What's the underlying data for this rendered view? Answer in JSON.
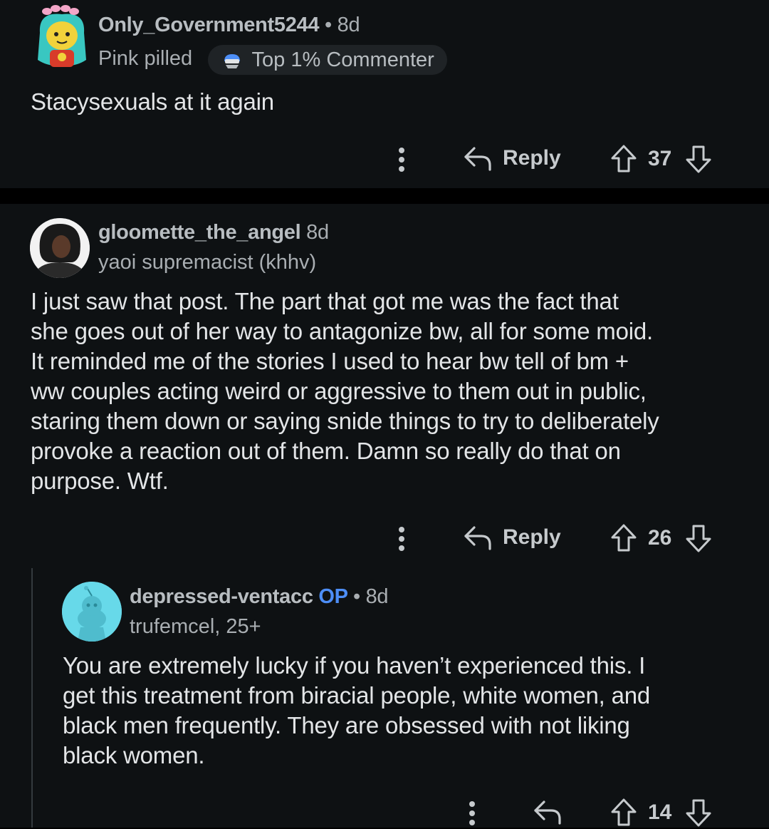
{
  "comments": [
    {
      "username": "Only_Government5244",
      "separator": "•",
      "time": "8d",
      "flair": "Pink pilled",
      "badge": "Top 1% Commenter",
      "text": "Stacysexuals at it again",
      "reply_label": "Reply",
      "score": "37"
    },
    {
      "username": "gloomette_the_angel",
      "time": "8d",
      "flair": "yaoi supremacist (khhv)",
      "text_lines": [
        "I just saw that post. The part that got me was the fact that",
        "she goes out of her way to antagonize bw, all for some moid.",
        "It reminded me of the stories I used to hear bw tell of bm +",
        "ww couples acting weird or aggressive to them out in public,",
        "staring them down or saying snide things to try to deliberately",
        "provoke a reaction out of them. Damn so really do that on",
        "purpose. Wtf."
      ],
      "reply_label": "Reply",
      "score": "26"
    },
    {
      "username": "depressed-ventacc",
      "op_tag": "OP",
      "separator": "•",
      "time": "8d",
      "flair": "trufemcel, 25+",
      "text_lines": [
        "You are extremely lucky if you haven’t experienced this. I",
        "get this treatment from biracial people, white women, and",
        "black men frequently. They are obsessed with not liking",
        "black women."
      ],
      "score": "14"
    }
  ],
  "icons": {
    "more": "vertical-dots-icon",
    "reply": "reply-arrow-icon",
    "upvote": "upvote-arrow-icon",
    "downvote": "downvote-arrow-icon",
    "badge": "commenter-badge-icon"
  },
  "colors": {
    "background": "#000000",
    "card": "#0e1113",
    "op_accent": "#4d8ef7",
    "snoo_avatar": "#67d9e9"
  }
}
